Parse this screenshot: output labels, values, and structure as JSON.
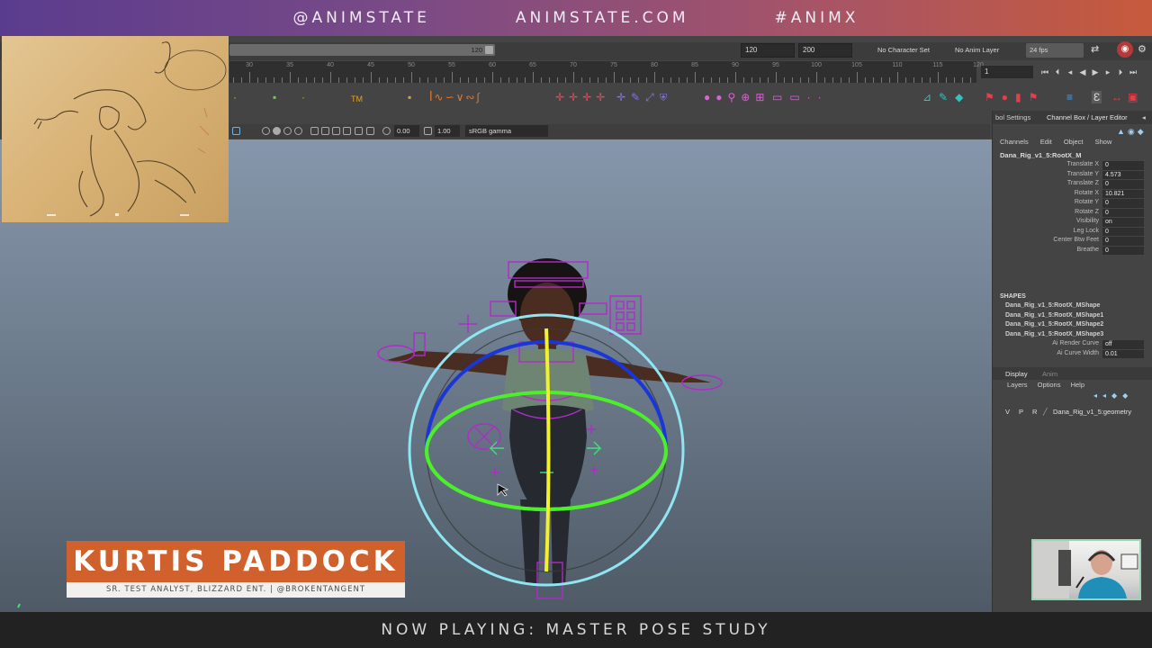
{
  "banner": {
    "handle": "@ANIMSTATE",
    "site": "ANIMSTATE.COM",
    "hashtag": "#ANIMX"
  },
  "footer": {
    "now_playing": "NOW PLAYING:  MASTER POSE STUDY"
  },
  "nametag": {
    "name": "KURTIS PADDOCK",
    "role": "SR. TEST ANALYST, BLIZZARD ENT. | @BROKENTANGENT"
  },
  "timeslider": {
    "range_end_in_bar": "120",
    "start_field": "120",
    "end_field": "200",
    "character_set": "No Character Set",
    "anim_layer": "No Anim Layer",
    "fps": "24 fps",
    "current_frame": "1",
    "ruler_labels": [
      "30",
      "35",
      "40",
      "45",
      "50",
      "55",
      "60",
      "65",
      "70",
      "75",
      "80",
      "85",
      "90",
      "95",
      "100",
      "105",
      "110",
      "115",
      "120"
    ]
  },
  "panel_toolbar": {
    "value_a": "0.00",
    "value_b": "1.00",
    "color_space": "sRGB gamma"
  },
  "channel_box": {
    "tabs": [
      "bol Settings",
      "Channel Box / Layer Editor"
    ],
    "menu": [
      "Channels",
      "Edit",
      "Object",
      "Show"
    ],
    "node": "Dana_Rig_v1_5:RootX_M",
    "channels": [
      {
        "name": "Translate X",
        "value": "0"
      },
      {
        "name": "Translate Y",
        "value": "4.573"
      },
      {
        "name": "Translate Z",
        "value": "0"
      },
      {
        "name": "Rotate X",
        "value": "10.821"
      },
      {
        "name": "Rotate Y",
        "value": "0"
      },
      {
        "name": "Rotate Z",
        "value": "0"
      },
      {
        "name": "Visibility",
        "value": "on"
      },
      {
        "name": "Leg Lock",
        "value": "0"
      },
      {
        "name": "Center Btw Feet",
        "value": "0"
      },
      {
        "name": "Breathe",
        "value": "0"
      }
    ],
    "shapes_header": "SHAPES",
    "shapes": [
      "Dana_Rig_v1_5:RootX_MShape",
      "Dana_Rig_v1_5:RootX_MShape1",
      "Dana_Rig_v1_5:RootX_MShape2",
      "Dana_Rig_v1_5:RootX_MShape3"
    ],
    "shape_attrs": [
      {
        "name": "Ai Render Curve",
        "value": "off"
      },
      {
        "name": "Ai Curve Width",
        "value": "0.01"
      }
    ]
  },
  "layer_editor": {
    "tabs": [
      "Display",
      "Anim"
    ],
    "menu": [
      "Layers",
      "Options",
      "Help"
    ],
    "vpr": [
      "V",
      "P",
      "R"
    ],
    "layer_name": "Dana_Rig_v1_5:geometry"
  },
  "colors": {
    "accent_orange": "#d0602c",
    "rotate_ring_blue": "#1a35d8",
    "rotate_ring_green": "#4cf02a",
    "rotate_ring_yellow": "#f2f22a",
    "outer_ring_cyan": "#8fe6f2",
    "rig_controls_magenta": "#b02bc8"
  }
}
